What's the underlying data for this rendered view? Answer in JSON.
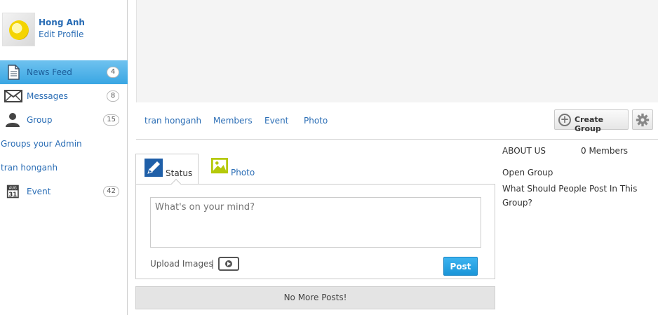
{
  "profile": {
    "name": "Hong Anh",
    "edit_label": "Edit Profile"
  },
  "sidebar": {
    "items": [
      {
        "label": "News Feed",
        "count": "4",
        "icon": "document-icon",
        "active": true
      },
      {
        "label": "Messages",
        "count": "8",
        "icon": "envelope-icon"
      },
      {
        "label": "Group",
        "count": "15",
        "icon": "user-icon"
      }
    ],
    "links": [
      {
        "label": "Groups your Admin"
      },
      {
        "label": "tran honganh"
      }
    ],
    "event": {
      "label": "Event",
      "count": "42",
      "icon": "calendar-icon",
      "month": "AUG",
      "day": "31"
    }
  },
  "group_nav": {
    "tabs": [
      "tran honganh",
      "Members",
      "Event",
      "Photo"
    ],
    "create_label": "Create Group"
  },
  "composer": {
    "tabs": [
      {
        "label": "Status",
        "icon": "pencil-icon"
      },
      {
        "label": "Photo",
        "icon": "photo-icon"
      }
    ],
    "placeholder": "What's on your mind?",
    "upload_label": "Upload Images",
    "separator": "|",
    "post_label": "Post"
  },
  "feed": {
    "no_more_label": "No More Posts!"
  },
  "about": {
    "title": "ABOUT US",
    "members": "0 Members",
    "type": "Open Group",
    "question": "What Should People Post In This Group?"
  },
  "colors": {
    "link": "#2a6db5",
    "accent": "#39a6e3",
    "post_button": "#1a95d8"
  }
}
